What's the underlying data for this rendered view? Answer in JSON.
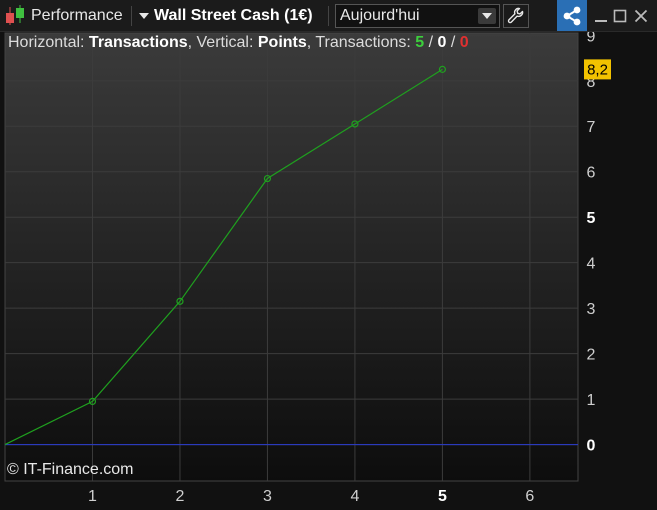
{
  "toolbar": {
    "indicator_label": "Performance",
    "instrument_label": "Wall Street Cash (1€)",
    "period_value": "Aujourd'hui"
  },
  "info": {
    "horizontal_prefix": "Horizontal: ",
    "horizontal_value": "Transactions",
    "vertical_prefix": ", Vertical: ",
    "vertical_value": "Points",
    "transactions_prefix": ", Transactions: ",
    "tx_winners": "5",
    "tx_neutral": "0",
    "tx_losers": "0",
    "sep": " / "
  },
  "credit": "© IT-Finance.com",
  "colors": {
    "line": "#1fa01f",
    "zero_line": "#2a3bd0",
    "winners": "#3ccf3c",
    "losers": "#e03030",
    "last_value_badge": "#f2c200",
    "share_button": "#2a6fb5"
  },
  "chart_data": {
    "type": "line",
    "x": [
      0,
      1,
      2,
      3,
      4,
      5
    ],
    "values": [
      0,
      0.95,
      3.15,
      5.85,
      7.05,
      8.25
    ],
    "xlim": [
      0,
      6.55
    ],
    "ylim": [
      -0.8,
      9.05
    ],
    "x_ticks": [
      1,
      2,
      3,
      4,
      5,
      6
    ],
    "y_ticks": [
      0,
      1,
      2,
      3,
      4,
      5,
      6,
      7,
      8,
      9
    ],
    "bold_x_tick": 5,
    "bold_y_ticks": [
      0,
      5
    ],
    "last_value_label": "8,2",
    "grid": true
  }
}
